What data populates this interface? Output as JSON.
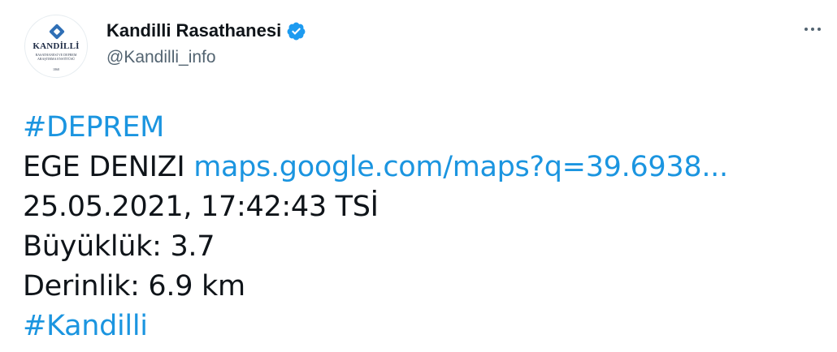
{
  "account": {
    "display_name": "Kandilli Rasathanesi",
    "handle": "@Kandilli_info",
    "verified_icon": "verified-badge-icon",
    "avatar": {
      "logo_title": "KANDİLLİ",
      "logo_subtitle": "RASATHANESİ VE DEPREM ARAŞTIRMA ENSTİTÜSÜ",
      "logo_year": "1868"
    }
  },
  "menu": {
    "icon": "more-options-icon"
  },
  "tweet": {
    "hashtag_1": "#DEPREM",
    "location": "EGE DENIZI",
    "map_link": "maps.google.com/maps?q=39.6938...",
    "datetime": "25.05.2021, 17:42:43 TSİ",
    "magnitude": "Büyüklük: 3.7",
    "depth": "Derinlik: 6.9 km",
    "hashtag_2": "#Kandilli"
  },
  "colors": {
    "link": "#1b95e0",
    "text": "#0f1419",
    "secondary": "#536471",
    "verified": "#1d9bf0"
  }
}
